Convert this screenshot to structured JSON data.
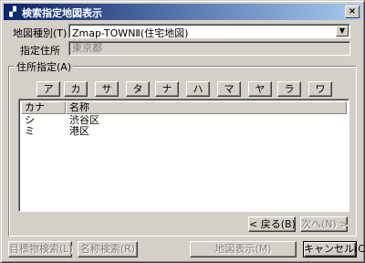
{
  "window": {
    "title": "検索指定地図表示",
    "close_glyph": "×"
  },
  "map_type": {
    "label": "地図種別(T)",
    "value": "Zmap-TOWNⅡ(住宅地図)"
  },
  "address": {
    "label": "指定住所",
    "value": "東京都"
  },
  "group": {
    "title": "住所指定(A)"
  },
  "kana_buttons": [
    "ア",
    "カ",
    "サ",
    "タ",
    "ナ",
    "ハ",
    "マ",
    "ヤ",
    "ラ",
    "ワ"
  ],
  "list": {
    "columns": [
      "カナ",
      "名称"
    ],
    "rows": [
      {
        "kana": "シ",
        "name": "渋谷区"
      },
      {
        "kana": "ミ",
        "name": "港区"
      }
    ]
  },
  "nav": {
    "back": "< 戻る(B)",
    "next": "次へ(N) >"
  },
  "footer": {
    "landmark_search": "目標物検索(L)",
    "name_search": "名称検索(R)",
    "map_display": "地図表示(M)",
    "cancel": "キャンセル(C)"
  }
}
